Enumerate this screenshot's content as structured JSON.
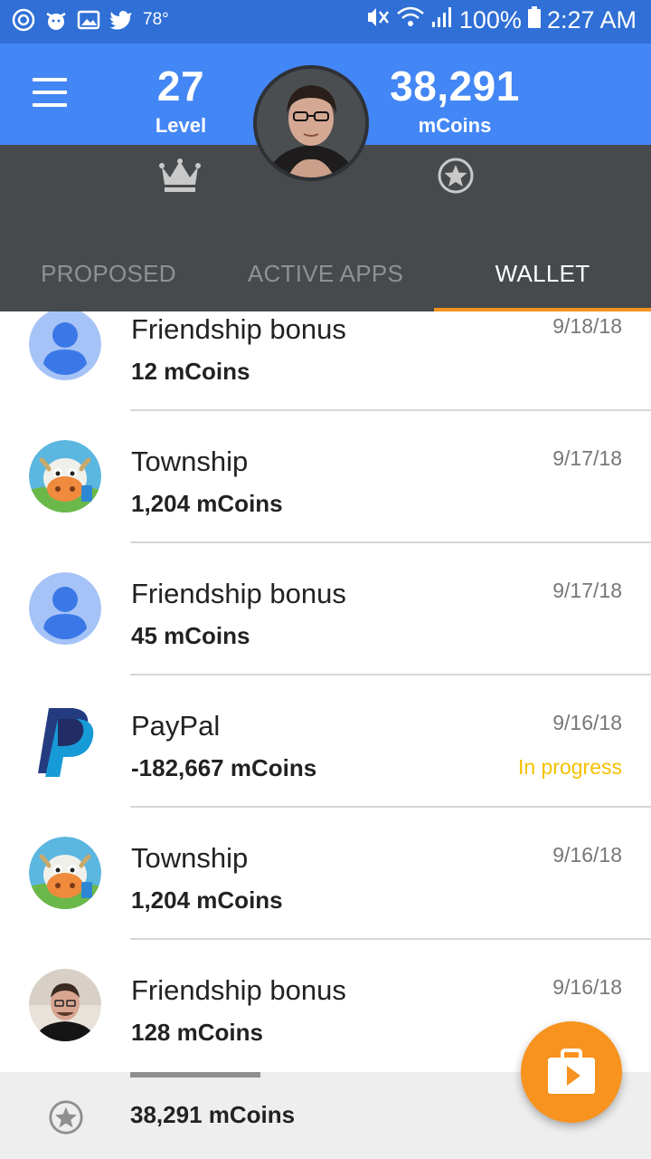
{
  "status_bar": {
    "temperature": "78°",
    "battery": "100%",
    "time": "2:27 AM"
  },
  "header": {
    "level_value": "27",
    "level_label": "Level",
    "coins_value": "38,291",
    "coins_label": "mCoins"
  },
  "tabs": [
    {
      "label": "PROPOSED",
      "active": false
    },
    {
      "label": "ACTIVE APPS",
      "active": false
    },
    {
      "label": "WALLET",
      "active": true
    }
  ],
  "transactions": [
    {
      "title": "Friendship bonus",
      "amount": "12 mCoins",
      "date": "9/18/18",
      "status": "",
      "icon": "default-user-avatar-icon"
    },
    {
      "title": "Township",
      "amount": "1,204 mCoins",
      "date": "9/17/18",
      "status": "",
      "icon": "township-app-icon"
    },
    {
      "title": "Friendship bonus",
      "amount": "45 mCoins",
      "date": "9/17/18",
      "status": "",
      "icon": "default-user-avatar-icon"
    },
    {
      "title": "PayPal",
      "amount": "-182,667 mCoins",
      "date": "9/16/18",
      "status": "In progress",
      "icon": "paypal-logo-icon"
    },
    {
      "title": "Township",
      "amount": "1,204 mCoins",
      "date": "9/16/18",
      "status": "",
      "icon": "township-app-icon"
    },
    {
      "title": "Friendship bonus",
      "amount": "128 mCoins",
      "date": "9/16/18",
      "status": "",
      "icon": "friend-photo-avatar"
    }
  ],
  "footer": {
    "total": "38,291 mCoins"
  },
  "colors": {
    "status_bar": "#2f6fd6",
    "header": "#4386f5",
    "dark_band": "#474a4d",
    "accent": "#f7931e",
    "in_progress": "#f5c000"
  }
}
